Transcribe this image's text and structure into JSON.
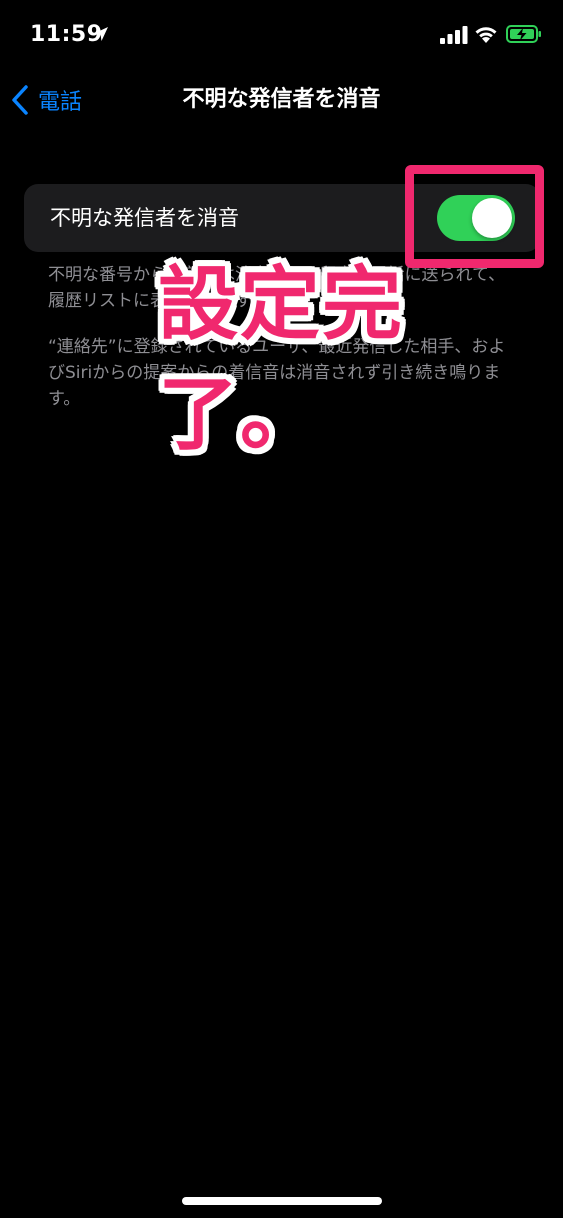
{
  "status_bar": {
    "time": "11:59",
    "icons": [
      "location-arrow-icon",
      "cellular-signal-icon",
      "wifi-icon",
      "battery-charging-icon"
    ]
  },
  "nav": {
    "back_label": "電話",
    "title": "不明な発信者を消音"
  },
  "setting": {
    "label": "不明な発信者を消音",
    "toggle_on": true
  },
  "footer": {
    "paragraph_1": "不明な番号からの着信は消音されて留守番電話に送られて、履歴リストに表示されます。",
    "paragraph_2": "“連絡先”に登録されているユーザ、最近発信した相手、およびSiriからの提案からの着信音は消音されず引き続き鳴ります。"
  },
  "annotation": {
    "text": "設定完了。"
  },
  "colors": {
    "accent_blue": "#0a84ff",
    "toggle_green": "#30d158",
    "annotation_pink": "#f0286e",
    "card_background": "#1c1c1e",
    "secondary_text": "#8e8e93"
  }
}
